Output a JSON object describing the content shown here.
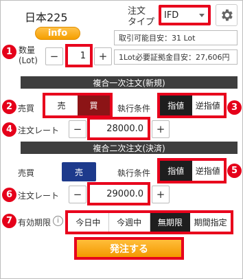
{
  "header": {
    "symbol": "日本225",
    "info_label": "info",
    "order_type_label_line1": "注文",
    "order_type_label_line2": "タイプ",
    "order_type_value": "IFD"
  },
  "quantity": {
    "label_line1": "数量",
    "label_line2": "(Lot)",
    "minus": "−",
    "value": "1",
    "plus": "+",
    "available_text": "取引可能目安：31 Lot",
    "margin_text": "1Lot必要証拠金目安：27,606円"
  },
  "first_order": {
    "band_title": "複合一次注文(新規)",
    "side_label": "売買",
    "sell_label": "売",
    "buy_label": "買",
    "condition_label": "執行条件",
    "limit_label": "指値",
    "stop_label": "逆指値",
    "rate_label": "注文レート",
    "minus": "−",
    "rate_value": "28000.0",
    "plus": "+"
  },
  "second_order": {
    "band_title": "複合二次注文(決済)",
    "side_label": "売買",
    "side_value": "売",
    "condition_label": "執行条件",
    "limit_label": "指値",
    "stop_label": "逆指値",
    "rate_label": "注文レート",
    "minus": "−",
    "rate_value": "29000.0",
    "plus": "+"
  },
  "validity": {
    "label": "有効期限",
    "info_glyph": "i",
    "options": [
      "今日中",
      "今週中",
      "無期限",
      "期間指定"
    ],
    "selected": "無期限"
  },
  "submit_label": "発注する",
  "badges": [
    "1",
    "2",
    "3",
    "4",
    "5",
    "6",
    "7"
  ],
  "colors": {
    "highlight_red": "#e8001c",
    "badge_red": "#e5001a",
    "sell_navy": "#1d3a8c",
    "buy_dark_red": "#8c1416",
    "selected_dark": "#1e1e1e",
    "accent_orange": "#f39800"
  },
  "icons": {
    "settings": "gear-icon",
    "info": "info-circle-icon",
    "dropdown": "chevron-down-icon"
  }
}
